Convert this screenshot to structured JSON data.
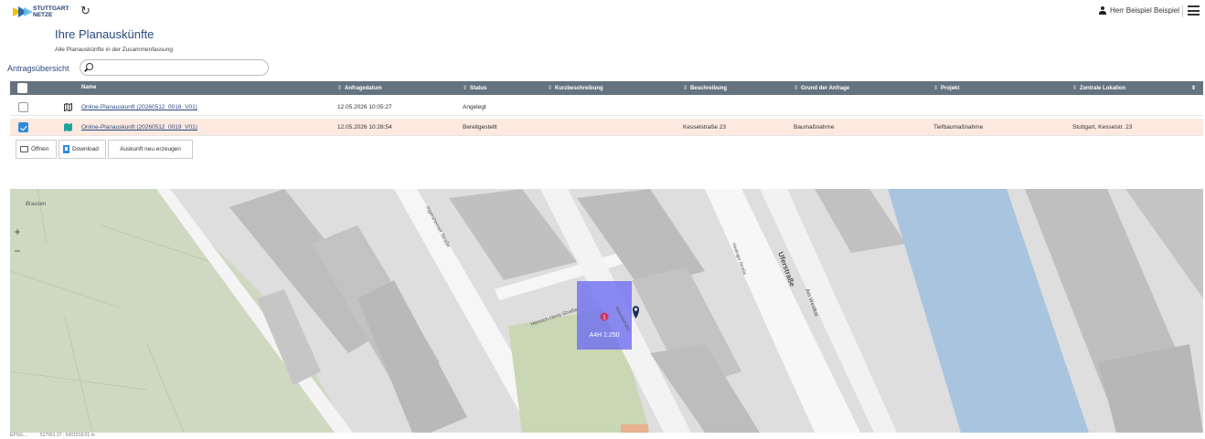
{
  "header": {
    "logo_line1": "STUTTGART",
    "logo_line2": "NETZE",
    "user_name": "Herr Beispiel Beispiel"
  },
  "page": {
    "title": "Ihre Planauskünfte",
    "subtitle": "Alle Planauskünfte in der Zusammenfassung",
    "overview_label": "Antragsübersicht"
  },
  "search": {
    "placeholder": ""
  },
  "table": {
    "columns": {
      "name": "Name",
      "date": "Anfragedatum",
      "status": "Status",
      "short": "Kurzbeschreibung",
      "desc": "Beschreibung",
      "reason": "Grund der Anfrage",
      "project": "Projekt",
      "location": "Zentrale Lokation"
    },
    "rows": [
      {
        "name": "Online-Planauskunft (20260512_0016_V01)",
        "date": "12.05.2026 10:05:27",
        "status": "Angelegt",
        "short": "",
        "desc": "",
        "reason": "",
        "project": "",
        "location": "",
        "selected": false
      },
      {
        "name": "Online-Planauskunft (20260512_0019_V01)",
        "date": "12.05.2026 10:28:54",
        "status": "Bereitgestellt",
        "short": "",
        "desc": "Kesselstraße 23",
        "reason": "Baumaßnahme",
        "project": "Tiefbaumaßnahme",
        "location": "Stuttgart, Kesselstr. 23",
        "selected": true
      }
    ]
  },
  "actions": {
    "open": "Öffnen",
    "download": "Download",
    "regenerate": "Auskunft neu erzeugen"
  },
  "map": {
    "zoom_in": "+",
    "zoom_out": "−",
    "labels": {
      "area": "Brausen",
      "street1": "Heinrich-Hertz-Straße",
      "street2": "Ingersheimer Straße",
      "street3": "Uferstraße",
      "street4": "Am Westkai",
      "street5": "Hedinger Straße",
      "street6": "Kesselstraße"
    },
    "selection_label": "A4H 1:250",
    "marker_number": "1"
  },
  "footer": {
    "crs": "EPSG:...",
    "coords": "517951.37 ; 5401518.01 m"
  },
  "colors": {
    "header_bg": "#657380",
    "selected_row": "#fde9df",
    "accent_blue": "#2e8bd8",
    "water": "#a9c4df",
    "green": "#c8d6b4",
    "selection": "#6e6ef0"
  }
}
